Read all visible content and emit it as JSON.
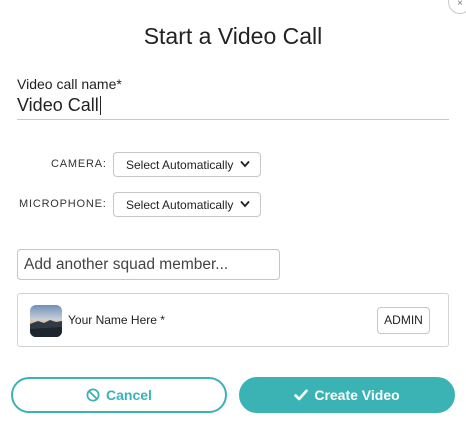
{
  "dialog": {
    "title": "Start a Video Call",
    "close_icon": "close-icon"
  },
  "call_name": {
    "label": "Video call name*",
    "value": "Video Call"
  },
  "devices": {
    "camera_label": "CAMERA:",
    "camera_value": "Select Automatically",
    "microphone_label": "MICROPHONE:",
    "microphone_value": "Select Automatically"
  },
  "squad": {
    "placeholder": "Add another squad member...",
    "members": [
      {
        "name": "Your Name Here *",
        "role": "ADMIN",
        "avatar": "landscape-avatar"
      }
    ]
  },
  "actions": {
    "cancel_label": "Cancel",
    "cancel_icon": "ban-icon",
    "create_label": "Create Video",
    "create_icon": "check-icon"
  },
  "colors": {
    "accent": "#3bb3b4",
    "border": "#c6c6c6"
  }
}
